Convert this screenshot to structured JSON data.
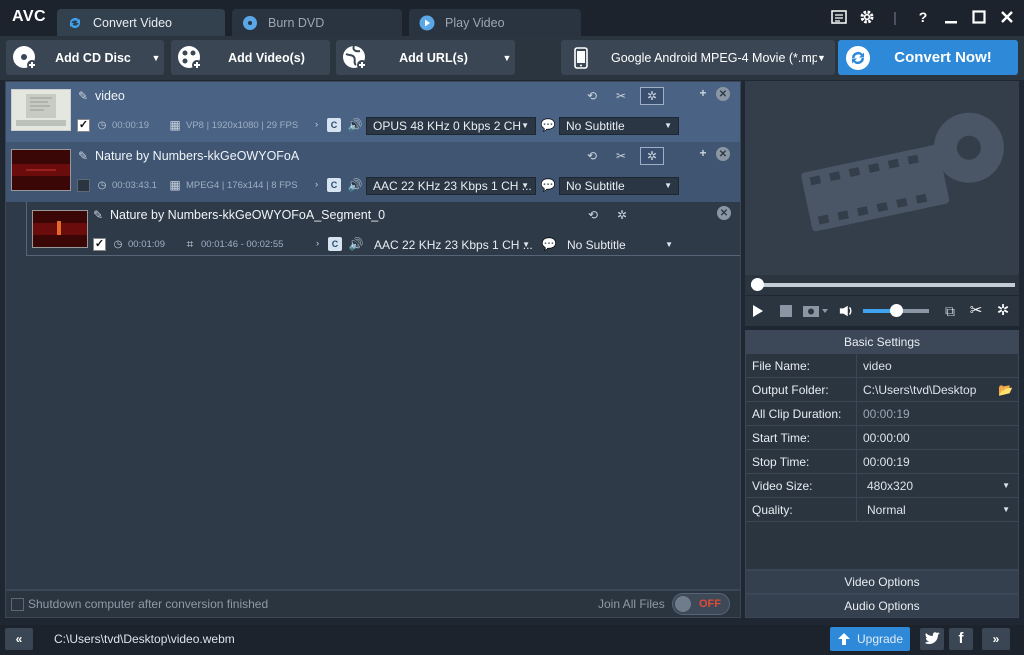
{
  "app": {
    "logo": "AVC"
  },
  "tabs": [
    {
      "label": "Convert Video",
      "icon": "refresh-icon"
    },
    {
      "label": "Burn DVD",
      "icon": "disc-icon"
    },
    {
      "label": "Play Video",
      "icon": "play-icon"
    }
  ],
  "toolbar": {
    "add_cd": "Add CD Disc",
    "add_video": "Add Video(s)",
    "add_url": "Add URL(s)",
    "profile": "Google Android MPEG-4 Movie (*.mp",
    "convert": "Convert Now!"
  },
  "files": [
    {
      "name": "video",
      "duration": "00:00:19",
      "info": "VP8 | 1920x1080 | 29 FPS",
      "audio": "OPUS 48 KHz 0 Kbps 2 CH",
      "subtitle": "No Subtitle",
      "checked": true
    },
    {
      "name": "Nature by Numbers-kkGeOWYOFoA",
      "duration": "00:03:43.1",
      "info": "MPEG4 | 176x144 | 8 FPS",
      "audio": "AAC 22 KHz 23 Kbps 1 CH ...",
      "subtitle": "No Subtitle",
      "checked": false
    },
    {
      "name": "Nature by Numbers-kkGeOWYOFoA_Segment_0",
      "duration": "00:01:09",
      "range": "00:01:46 - 00:02:55",
      "audio": "AAC 22 KHz 23 Kbps 1 CH ...",
      "subtitle": "No Subtitle",
      "checked": true
    }
  ],
  "list_footer": {
    "shutdown": "Shutdown computer after conversion finished",
    "join": "Join All Files",
    "toggle": "OFF"
  },
  "status": {
    "path": "C:\\Users\\tvd\\Desktop\\video.webm",
    "upgrade": "Upgrade"
  },
  "player": {
    "seek_fraction": 0.0,
    "volume_fraction": 0.5
  },
  "settings": {
    "title": "Basic Settings",
    "rows": [
      {
        "key": "File Name:",
        "value": "video"
      },
      {
        "key": "Output Folder:",
        "value": "C:\\Users\\tvd\\Desktop"
      },
      {
        "key": "All Clip Duration:",
        "value": "00:00:19"
      },
      {
        "key": "Start Time:",
        "value": "00:00:00"
      },
      {
        "key": "Stop Time:",
        "value": "00:00:19"
      },
      {
        "key": "Video Size:",
        "value": "480x320"
      },
      {
        "key": "Quality:",
        "value": "Normal"
      }
    ],
    "video_options": "Video Options",
    "audio_options": "Audio Options"
  },
  "colors": {
    "accent": "#2e8ad8",
    "selected_row": "#4a6283",
    "toggle_off": "#e04a3a"
  }
}
